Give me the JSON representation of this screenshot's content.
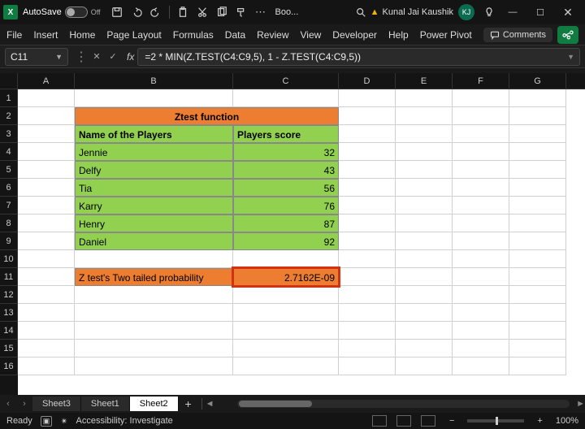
{
  "titlebar": {
    "autosave_label": "AutoSave",
    "autosave_state": "Off",
    "doc_title": "Boo...",
    "user_name": "Kunal Jai Kaushik",
    "user_initials": "KJ"
  },
  "ribbon": {
    "tabs": [
      "File",
      "Insert",
      "Home",
      "Page Layout",
      "Formulas",
      "Data",
      "Review",
      "View",
      "Developer",
      "Help",
      "Power Pivot"
    ],
    "comments_label": "Comments"
  },
  "formula_bar": {
    "name_box": "C11",
    "formula": "=2 * MIN(Z.TEST(C4:C9,5), 1 - Z.TEST(C4:C9,5))"
  },
  "columns": [
    "A",
    "B",
    "C",
    "D",
    "E",
    "F",
    "G"
  ],
  "rows": [
    "1",
    "2",
    "3",
    "4",
    "5",
    "6",
    "7",
    "8",
    "9",
    "10",
    "11",
    "12",
    "13",
    "14",
    "15",
    "16"
  ],
  "sheet": {
    "title_row": "Ztest function",
    "headers": {
      "b": "Name of the Players",
      "c": "Players score"
    },
    "data": [
      {
        "name": "Jennie",
        "score": "32"
      },
      {
        "name": "Delfy",
        "score": "43"
      },
      {
        "name": "Tia",
        "score": "56"
      },
      {
        "name": "Karry",
        "score": "76"
      },
      {
        "name": "Henry",
        "score": "87"
      },
      {
        "name": "Daniel",
        "score": "92"
      }
    ],
    "result_label": "Z test's Two tailed probability",
    "result_value": "2.7162E-09"
  },
  "tabs": {
    "sheets": [
      "Sheet3",
      "Sheet1",
      "Sheet2"
    ],
    "active": "Sheet2"
  },
  "status": {
    "ready": "Ready",
    "accessibility": "Accessibility: Investigate",
    "zoom": "100%"
  }
}
